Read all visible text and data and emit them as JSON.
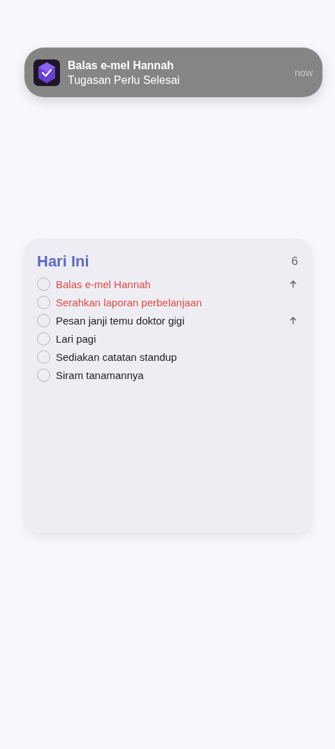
{
  "notification": {
    "title": "Balas e-mel Hannah",
    "body": "Tugasan Perlu Selesai",
    "time": "now"
  },
  "widget": {
    "title": "Hari Ini",
    "count": "6",
    "tasks": [
      {
        "label": "Balas e-mel Hannah",
        "overdue": true,
        "priority": true,
        "checked": false
      },
      {
        "label": "Serahkan laporan perbelanjaan",
        "overdue": true,
        "priority": false,
        "checked": false
      },
      {
        "label": "Pesan janji temu doktor gigi",
        "overdue": false,
        "priority": true,
        "checked": false
      },
      {
        "label": "Lari pagi",
        "overdue": false,
        "priority": false,
        "checked": false
      },
      {
        "label": "Sediakan catatan standup",
        "overdue": false,
        "priority": false,
        "checked": false
      },
      {
        "label": "Siram tanamannya",
        "overdue": false,
        "priority": false,
        "checked": false
      }
    ]
  }
}
